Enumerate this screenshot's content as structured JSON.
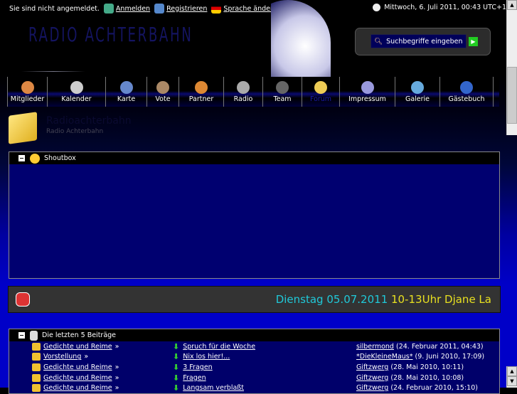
{
  "topbar": {
    "status": "Sie sind nicht angemeldet.",
    "login": "Anmelden",
    "register": "Registrieren",
    "language": "Sprache ändern",
    "datetime": "Mittwoch, 6. Juli 2011, 00:43 UTC+1"
  },
  "logo": "RADIO ACHTERBAHN",
  "search": {
    "placeholder": "Suchbegriffe eingeben"
  },
  "nav": [
    {
      "label": "Mitglieder"
    },
    {
      "label": "Kalender"
    },
    {
      "label": "Karte"
    },
    {
      "label": "Vote"
    },
    {
      "label": "Partner"
    },
    {
      "label": "Radio"
    },
    {
      "label": "Team"
    },
    {
      "label": "Forum",
      "active": true
    },
    {
      "label": "Impressum"
    },
    {
      "label": "Galerie"
    },
    {
      "label": "Gästebuch"
    }
  ],
  "forum": {
    "title": "Radioachterbahn",
    "subtitle": "Radio Achterbahn"
  },
  "shoutbox": {
    "title": "Shoutbox"
  },
  "ticker": {
    "date": "Dienstag 05.07.2011",
    "text": "10-13Uhr Djane La",
    "colors": {
      "date": "#20c8d8",
      "text": "#e8e020"
    }
  },
  "latest": {
    "title": "Die letzten 5 Beiträge",
    "rows": [
      {
        "board": "Gedichte und Reime",
        "topic": "Spruch für die Woche",
        "user": "silbermond",
        "date": "(24. Februar 2011, 04:43)"
      },
      {
        "board": "Vorstellung",
        "topic": "Nix los hier!...",
        "user": "*DieKleineMaus*",
        "date": "(9. Juni 2010, 17:09)"
      },
      {
        "board": "Gedichte und Reime",
        "topic": "3 Fragen",
        "user": "Giftzwerg",
        "date": "(28. Mai 2010, 10:11)"
      },
      {
        "board": "Gedichte und Reime",
        "topic": "Fragen",
        "user": "Giftzwerg",
        "date": "(28. Mai 2010, 10:08)"
      },
      {
        "board": "Gedichte und Reime",
        "topic": "Langsam verblaßt",
        "user": "Giftzwerg",
        "date": "(24. Februar 2010, 15:10)"
      }
    ]
  }
}
